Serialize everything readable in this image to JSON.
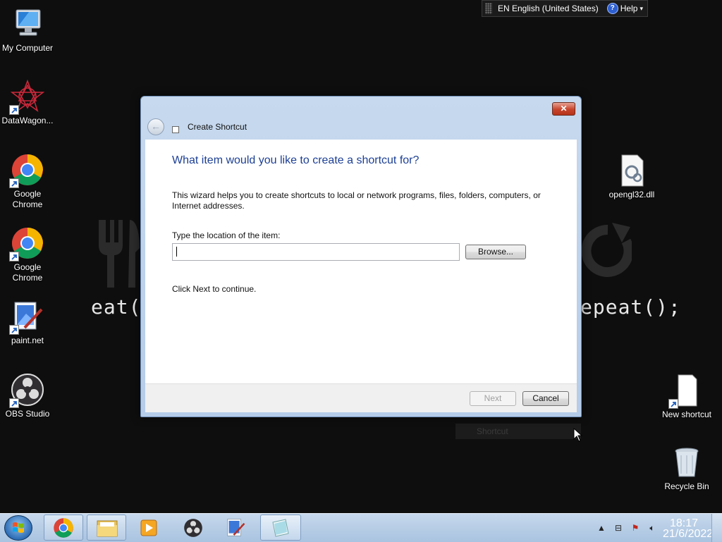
{
  "language_bar": {
    "language": "EN English (United States)",
    "help": "Help"
  },
  "desktop_icons": {
    "my_computer": "My Computer",
    "datawagon": "DataWagon...",
    "chrome1": "Google Chrome",
    "chrome2": "Google Chrome",
    "paintnet": "paint.net",
    "obs": "OBS Studio",
    "opengl": "opengl32.dll",
    "new_shortcut": "New shortcut",
    "recycle_bin": "Recycle Bin"
  },
  "wallpaper": {
    "left_text": "eat(",
    "right_text": "epeat();"
  },
  "dialog": {
    "title": "Create Shortcut",
    "heading": "What item would you like to create a shortcut for?",
    "description": "This wizard helps you to create shortcuts to local or network programs, files, folders, computers, or Internet addresses.",
    "location_label": "Type the location of the item:",
    "location_value": "",
    "browse": "Browse...",
    "next_hint": "Click Next to continue.",
    "next": "Next",
    "cancel": "Cancel",
    "close": "✕"
  },
  "ghost_label": "Shortcut",
  "taskbar": {
    "time": "18:17",
    "date": "21/6/2022"
  },
  "colors": {
    "heading": "#1c3f94",
    "close": "#c7432b",
    "taskbar": "#b7cce4"
  },
  "icons": [
    "computer-icon",
    "datawagon-icon",
    "chrome-icon",
    "paintnet-icon",
    "obs-icon",
    "dll-icon",
    "file-icon",
    "recycle-bin-icon",
    "windows-start-icon",
    "explorer-icon",
    "media-player-icon",
    "notepad-icon"
  ]
}
